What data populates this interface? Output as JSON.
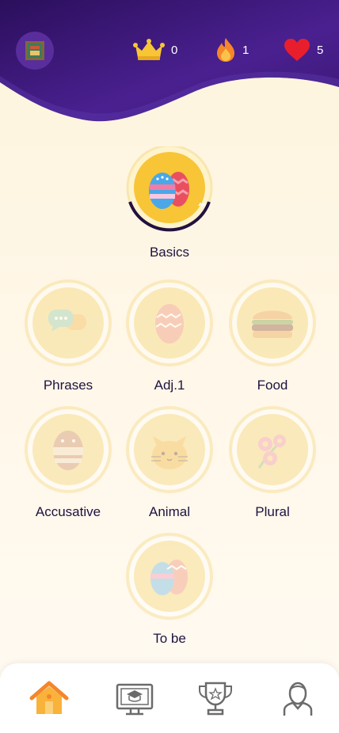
{
  "stats": {
    "crowns": "0",
    "streak": "1",
    "hearts": "5"
  },
  "skills": {
    "basics": "Basics",
    "phrases": "Phrases",
    "adj1": "Adj.1",
    "food": "Food",
    "accusative": "Accusative",
    "animal": "Animal",
    "plural": "Plural",
    "tobe": "To be"
  },
  "nav": {
    "active": "home"
  },
  "colors": {
    "header_purple": "#3b1574",
    "accent_yellow": "#f8c536",
    "text_dark": "#1d1240"
  },
  "icons": [
    "profile-avatar-icon",
    "crown-icon",
    "fire-icon",
    "heart-icon",
    "home-icon",
    "courses-icon",
    "trophy-icon",
    "profile-icon"
  ]
}
